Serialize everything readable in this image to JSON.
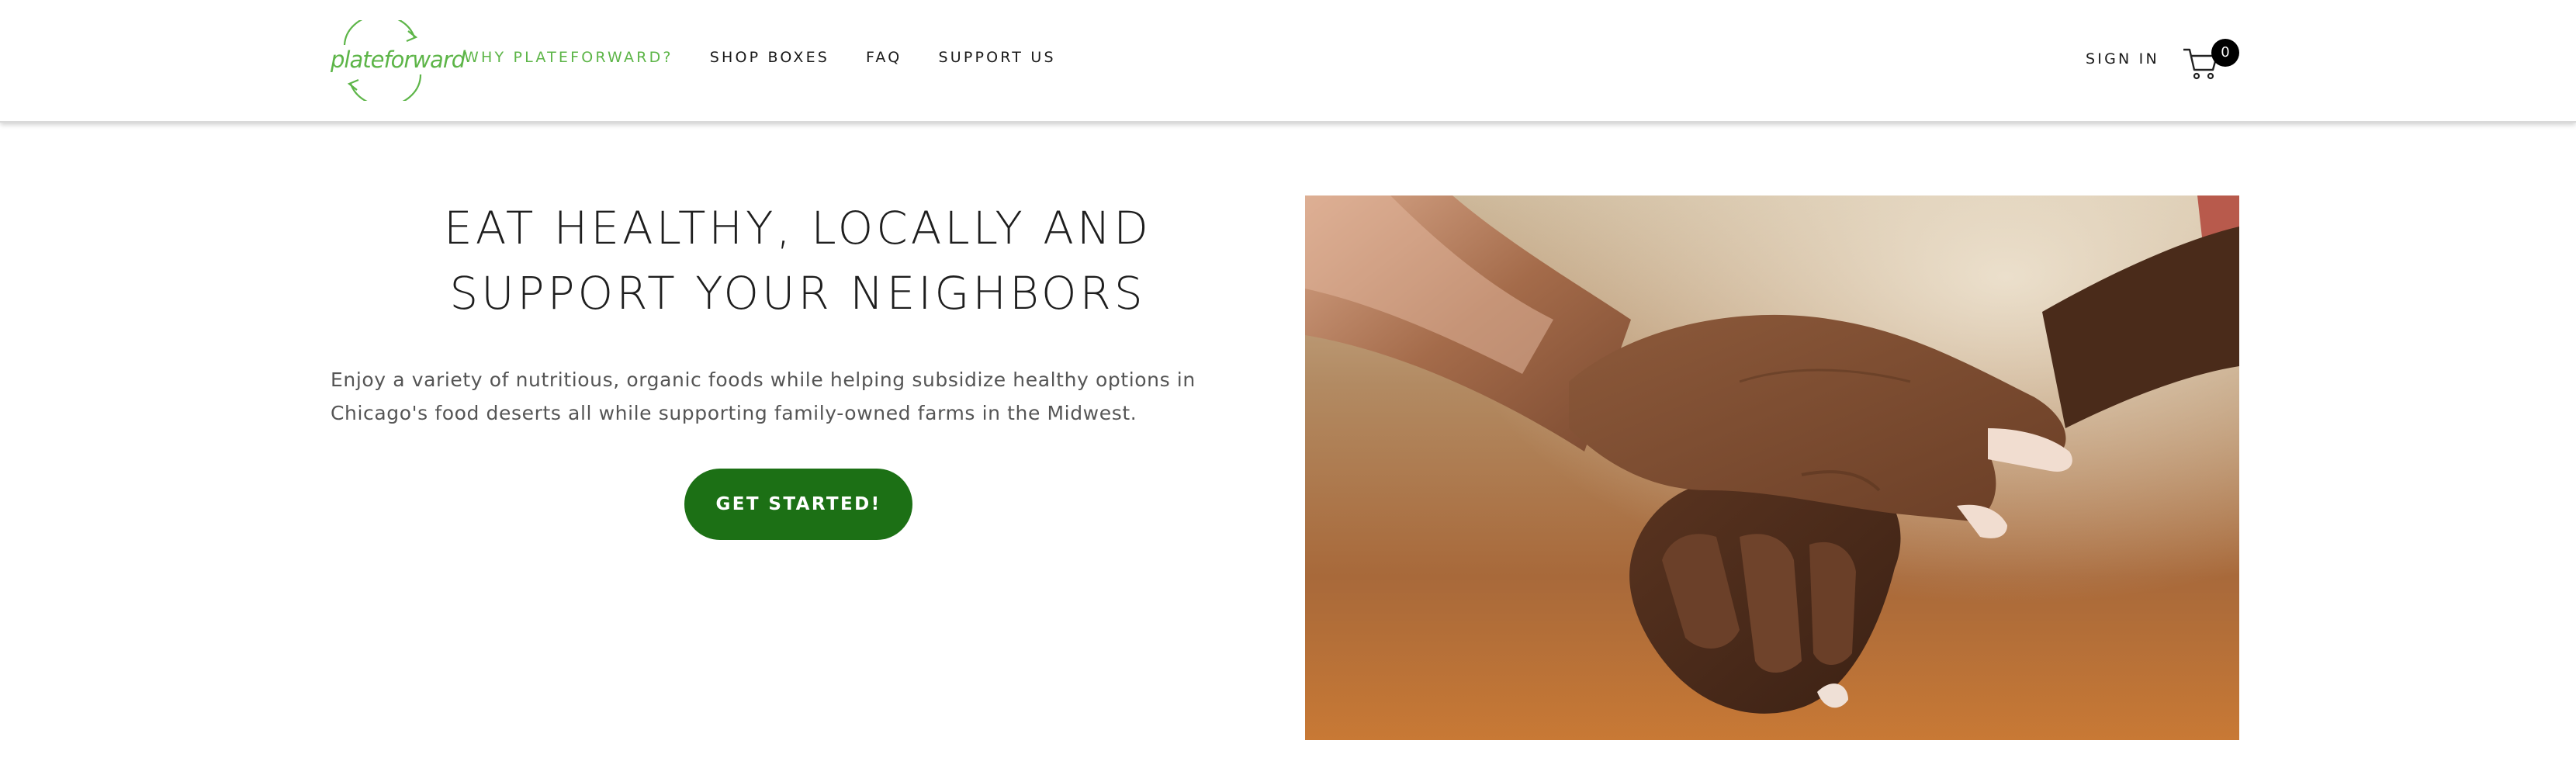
{
  "header": {
    "logo_text": "plateforward",
    "nav": [
      {
        "label": "WHY PLATEFORWARD?",
        "active": true
      },
      {
        "label": "SHOP BOXES",
        "active": false
      },
      {
        "label": "FAQ",
        "active": false
      },
      {
        "label": "SUPPORT US",
        "active": false
      }
    ],
    "signin_label": "SIGN IN",
    "cart_count": "0",
    "cart_icon": "shopping-cart-icon"
  },
  "hero": {
    "title": "EAT HEALTHY, LOCALLY AND SUPPORT YOUR NEIGHBORS",
    "description": "Enjoy a variety of nutritious, organic foods while helping subsidize healthy options in Chicago's food deserts all while supporting family-owned farms in the Midwest.",
    "cta_label": "GET STARTED!"
  },
  "colors": {
    "brand_green": "#5db548",
    "cta_green": "#1c7015",
    "badge": "#000000"
  }
}
